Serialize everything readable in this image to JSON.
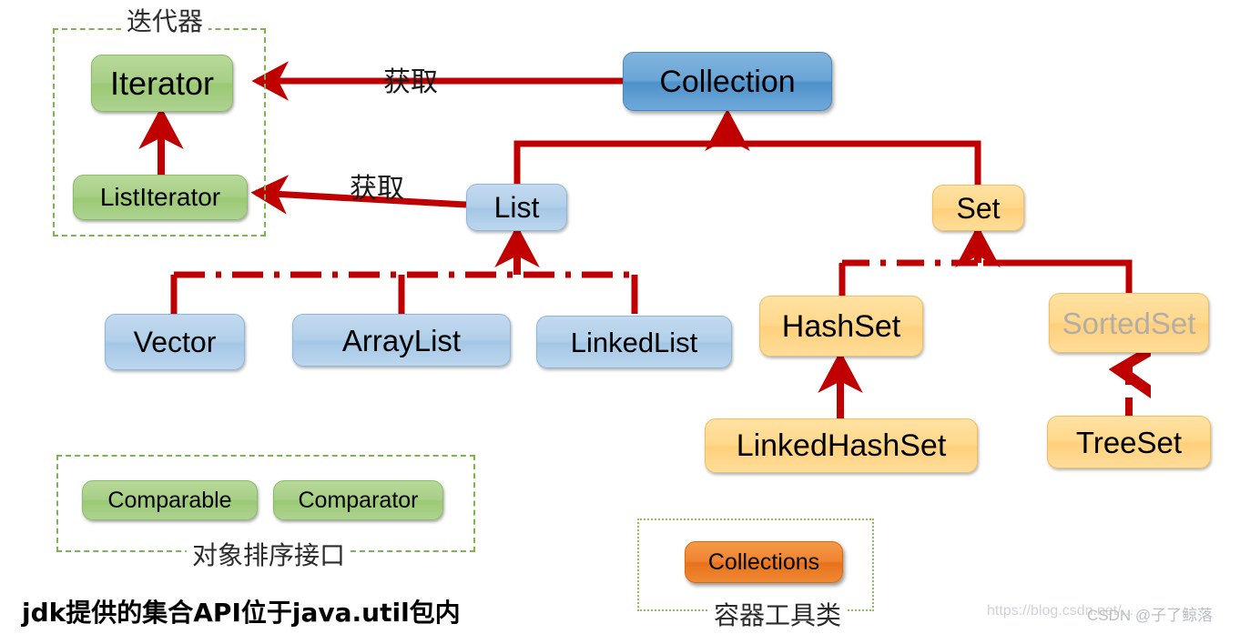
{
  "diagram": {
    "title_caption": "jdk提供的集合API位于java.util包内",
    "watermark_left": "https://blog.csdn.net/...",
    "watermark_right": "CSDN @子了鲸落",
    "accent_red": "#c00000",
    "frame_green": "#7fb350",
    "frame_dotted_green": "#8fbf55"
  },
  "groups": {
    "iterator": {
      "label": "迭代器"
    },
    "sorting": {
      "label": "对象排序接口"
    },
    "tools": {
      "label": "容器工具类"
    }
  },
  "edge_labels": {
    "get_iterator": "获取",
    "get_listiterator": "获取"
  },
  "nodes": {
    "iterator": {
      "label": "Iterator",
      "color": "#a7cf86"
    },
    "listiterator": {
      "label": "ListIterator",
      "color": "#a7cf86"
    },
    "collection": {
      "label": "Collection",
      "color": "#6aa5d6"
    },
    "list": {
      "label": "List",
      "color": "#b2cfe9"
    },
    "set": {
      "label": "Set",
      "color": "#ffd88a"
    },
    "vector": {
      "label": "Vector",
      "color": "#b2cfe9"
    },
    "arraylist": {
      "label": "ArrayList",
      "color": "#b2cfe9"
    },
    "linkedlist": {
      "label": "LinkedList",
      "color": "#b2cfe9"
    },
    "hashset": {
      "label": "HashSet",
      "color": "#ffd88a"
    },
    "sortedset": {
      "label": "SortedSet",
      "color": "#ffd88a",
      "text_color": "#b3adaa"
    },
    "linkedhashset": {
      "label": "LinkedHashSet",
      "color": "#ffd88a"
    },
    "treeset": {
      "label": "TreeSet",
      "color": "#ffd88a"
    },
    "comparable": {
      "label": "Comparable",
      "color": "#a7cf86"
    },
    "comparator": {
      "label": "Comparator",
      "color": "#a7cf86"
    },
    "collections": {
      "label": "Collections",
      "color": "#ef8330"
    }
  },
  "relations": [
    {
      "from": "collection",
      "to": "iterator",
      "style": "solid",
      "label": "获取"
    },
    {
      "from": "list",
      "to": "listiterator",
      "style": "solid",
      "label": "获取"
    },
    {
      "from": "listiterator",
      "to": "iterator",
      "style": "solid",
      "label": ""
    },
    {
      "from": "list",
      "to": "collection",
      "style": "solid",
      "label": ""
    },
    {
      "from": "set",
      "to": "collection",
      "style": "solid",
      "label": ""
    },
    {
      "from": "vector",
      "to": "list",
      "style": "dashdot",
      "label": ""
    },
    {
      "from": "arraylist",
      "to": "list",
      "style": "dashdot",
      "label": ""
    },
    {
      "from": "linkedlist",
      "to": "list",
      "style": "dashdot",
      "label": ""
    },
    {
      "from": "hashset",
      "to": "set",
      "style": "dashdot",
      "label": ""
    },
    {
      "from": "sortedset",
      "to": "set",
      "style": "solid",
      "label": ""
    },
    {
      "from": "linkedhashset",
      "to": "hashset",
      "style": "solid",
      "label": ""
    },
    {
      "from": "treeset",
      "to": "sortedset",
      "style": "dashed",
      "label": ""
    }
  ]
}
